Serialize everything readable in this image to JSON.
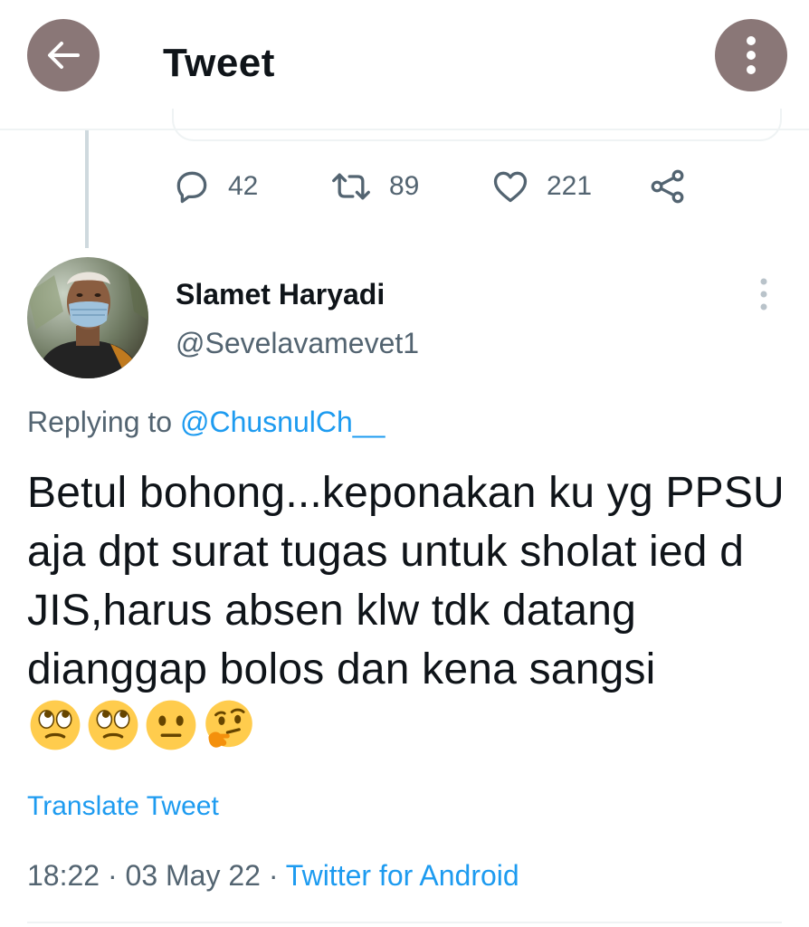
{
  "header": {
    "title": "Tweet",
    "back_icon": "back-arrow-icon",
    "more_icon": "vertical-dots-icon"
  },
  "parent_actions": {
    "reply_count": "42",
    "retweet_count": "89",
    "like_count": "221"
  },
  "tweet": {
    "author_name": "Slamet Haryadi",
    "author_handle": "@Sevelavamevet1",
    "replying_prefix": "Replying to ",
    "replying_mention": "@ChusnulCh__",
    "text": "Betul bohong...keponakan ku yg PPSU aja dpt surat tugas untuk sholat ied d JIS,harus absen klw tdk datang dianggap bolos dan kena sangsi",
    "emojis": [
      "face-with-rolling-eyes",
      "face-with-rolling-eyes",
      "neutral-face",
      "thinking-face"
    ],
    "translate_label": "Translate Tweet",
    "time": "18:22",
    "separator": " · ",
    "date": "03 May 22",
    "source": "Twitter for Android"
  },
  "colors": {
    "accent": "#1d9bf0",
    "secondary_text": "#536471",
    "header_button": "#8a7777"
  }
}
